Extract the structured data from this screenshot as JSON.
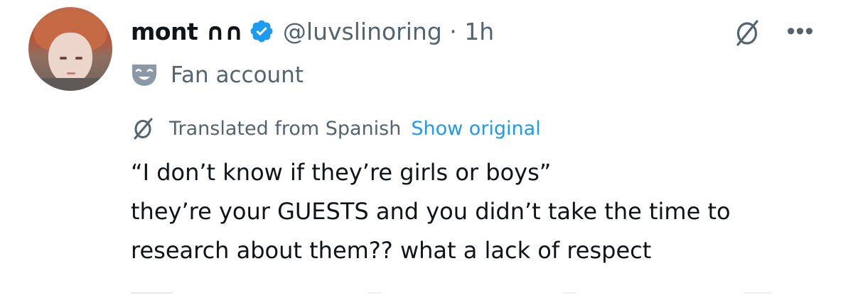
{
  "tweet": {
    "display_name": "mont ∩∩",
    "handle": "@luvslinoring",
    "separator": "·",
    "time": "1h",
    "account_label": "Fan account",
    "translated_note": "Translated from Spanish",
    "show_original": "Show original",
    "more_icon_text": "•••",
    "text_lines": [
      "“I don’t know if they’re girls or boys”",
      "they’re your GUESTS and you didn’t take the time to",
      "research about them?? what a lack of respect"
    ]
  },
  "icons": {
    "verified": "verified-badge-icon",
    "translate": "translate-icon",
    "more": "more-icon",
    "label": "theater-mask-icon"
  },
  "colors": {
    "primary_text": "#0f1419",
    "secondary_text": "#536471",
    "link": "#1d9bf0",
    "verified": "#1d9bf0"
  }
}
